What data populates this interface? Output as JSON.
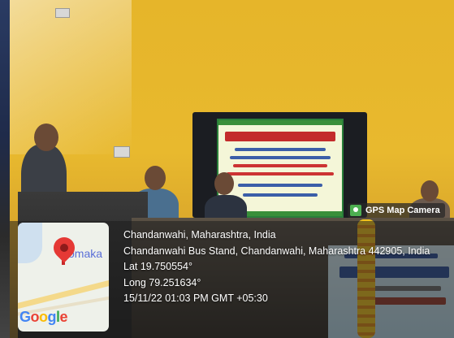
{
  "badge": {
    "label": "GPS Map Camera",
    "icon": "gps-map-camera-icon"
  },
  "map": {
    "place_text": "omaka",
    "logo": [
      "G",
      "o",
      "o",
      "g",
      "l",
      "e"
    ]
  },
  "location": {
    "title": "Chandanwahi, Maharashtra, India",
    "address": "Chandanwahi Bus Stand, Chandanwahi, Maharashtra 442905, India",
    "lat": "Lat 19.750554°",
    "long": "Long 79.251634°",
    "datetime": "15/11/22 01:03 PM GMT +05:30"
  },
  "colors": {
    "wall": "#e6b52a",
    "pin": "#e53935",
    "badge_icon": "#4caf50"
  }
}
